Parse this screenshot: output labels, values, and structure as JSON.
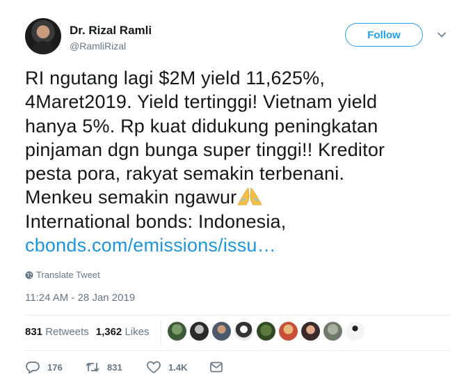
{
  "user": {
    "name": "Dr. Rizal Ramli",
    "handle": "@RamliRizal",
    "follow_label": "Follow"
  },
  "tweet": {
    "lines": [
      "RI ngutang lagi $2M yield 11,625%,",
      "4Maret2019. Yield tertinggi! Vietnam yield",
      "hanya 5%.  Rp kuat didukung peningkatan",
      "pinjaman dgn bunga super tinggi!! Kreditor",
      "pesta pora, rakyat semakin terbenani.",
      "Menkeu semakin ngawur",
      "International bonds: Indonesia,"
    ],
    "link": "cbonds.com/emissions/issu…",
    "emoji": "folded-hands-icon",
    "translate_label": "Translate Tweet",
    "timestamp": "11:24 AM - 28 Jan 2019"
  },
  "stats": {
    "retweets_count": "831",
    "retweets_label": "Retweets",
    "likes_count": "1,362",
    "likes_label": "Likes"
  },
  "actions": {
    "replies": "176",
    "retweets": "831",
    "likes": "1.4K"
  },
  "colors": {
    "accent": "#1da1f2",
    "link": "#1b95e0",
    "muted": "#657786",
    "divider": "#e6ecf0"
  }
}
